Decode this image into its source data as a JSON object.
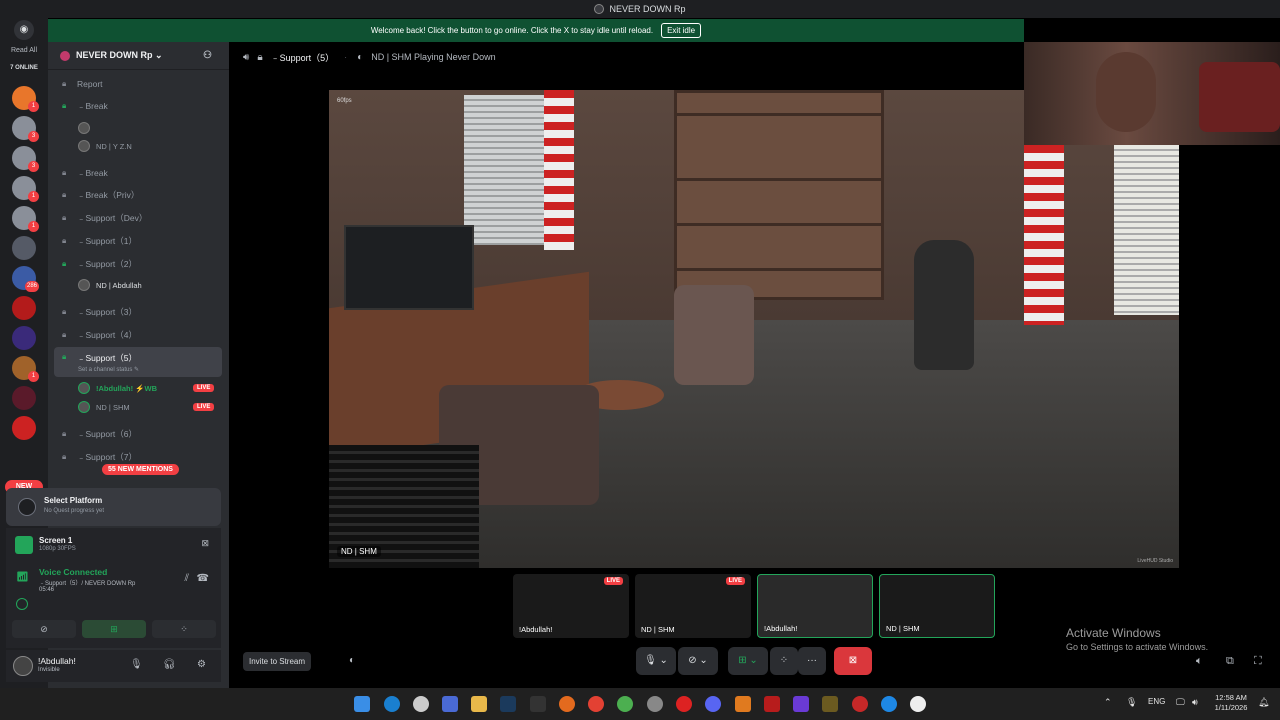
{
  "app": {
    "title": "NEVER DOWN Rp"
  },
  "banner": {
    "message": "Welcome back! Click the button to go online. Click the X to stay idle until reload.",
    "button": "Exit idle"
  },
  "rail": {
    "read_all": "Read All",
    "online": "7 ONLINE",
    "new_label": "NEW",
    "servers": [
      {
        "name": "server-1",
        "badge": "1",
        "color": "#e8762b"
      },
      {
        "name": "server-2",
        "badge": "3",
        "color": "#8a8f99"
      },
      {
        "name": "server-3",
        "badge": "3",
        "color": "#8a8f99"
      },
      {
        "name": "server-4",
        "badge": "1",
        "color": "#8a8f99"
      },
      {
        "name": "server-5",
        "badge": "1",
        "color": "#8a8f99"
      },
      {
        "name": "server-6",
        "badge": "",
        "color": "#555a66"
      },
      {
        "name": "server-7",
        "badge": "286",
        "color": "#3b5ba5"
      },
      {
        "name": "server-8",
        "badge": "",
        "color": "#b31b1b"
      },
      {
        "name": "server-9",
        "badge": "",
        "color": "#3a2a7a"
      },
      {
        "name": "server-10",
        "badge": "1",
        "color": "#a0622a"
      },
      {
        "name": "server-11",
        "badge": "",
        "color": "#5a1a2a"
      },
      {
        "name": "server-12",
        "badge": "",
        "color": "#c22"
      }
    ]
  },
  "sidebar": {
    "server_name": "NEVER DOWN Rp ⌄",
    "channels": [
      {
        "label": "Report",
        "icon": "lock",
        "green": false
      },
      {
        "label": "﹣Break",
        "icon": "lock",
        "green": true
      },
      {
        "label": "﹣Break",
        "icon": "lock",
        "green": false
      },
      {
        "label": "﹣Break（Priv）",
        "icon": "lock",
        "green": false
      },
      {
        "label": "﹣Support（Dev）",
        "icon": "lock",
        "green": false
      },
      {
        "label": "﹣Support（1）",
        "icon": "lock",
        "green": false
      },
      {
        "label": "﹣Support（2）",
        "icon": "lock",
        "green": true
      },
      {
        "label": "﹣Support（3）",
        "icon": "lock",
        "green": false
      },
      {
        "label": "﹣Support（4）",
        "icon": "lock",
        "green": false
      },
      {
        "label": "﹣Support（5）",
        "icon": "lock",
        "green": true
      },
      {
        "label": "﹣Support（6）",
        "icon": "lock",
        "green": false
      },
      {
        "label": "﹣Support（7）",
        "icon": "lock",
        "green": false
      }
    ],
    "break_users": [
      "",
      "ND | Y Z.N"
    ],
    "support2_user": "ND | Abdullah",
    "support5_status": "Set a channel status ✎",
    "support5_users": [
      {
        "name": "!Abdullah! ⚡WB",
        "live": "LIVE"
      },
      {
        "name": "ND | SHM",
        "live": "LIVE"
      }
    ],
    "mentions": "55 NEW MENTIONS"
  },
  "quest": {
    "title": "Select Platform",
    "subtitle": "No Quest progress yet"
  },
  "screen": {
    "name": "Screen 1",
    "quality": "1080p 30FPS"
  },
  "voice": {
    "status": "Voice Connected",
    "channel": "﹣Support（5）/ NEVER DOWN Rp",
    "time": "05:46"
  },
  "user": {
    "name": "!Abdullah!",
    "status": "Invisible"
  },
  "header": {
    "channel": "﹣Support（5）",
    "activity": "ND | SHM Playing Never Down"
  },
  "stream": {
    "fps": "60fps",
    "tag": "ND | SHM",
    "watermark": "LiveHUD Studio"
  },
  "thumbs": [
    {
      "label": "!Abdullah!",
      "live": "LIVE"
    },
    {
      "label": "ND | SHM",
      "live": "LIVE"
    },
    {
      "label": "!Abdullah!",
      "live": ""
    },
    {
      "label": "ND | SHM",
      "live": ""
    }
  ],
  "invite": "Invite to Stream",
  "activate": {
    "title": "Activate Windows",
    "sub": "Go to Settings to activate Windows."
  },
  "tray": {
    "lang": "ENG",
    "time": "12:58 AM",
    "date": "1/11/2026"
  }
}
